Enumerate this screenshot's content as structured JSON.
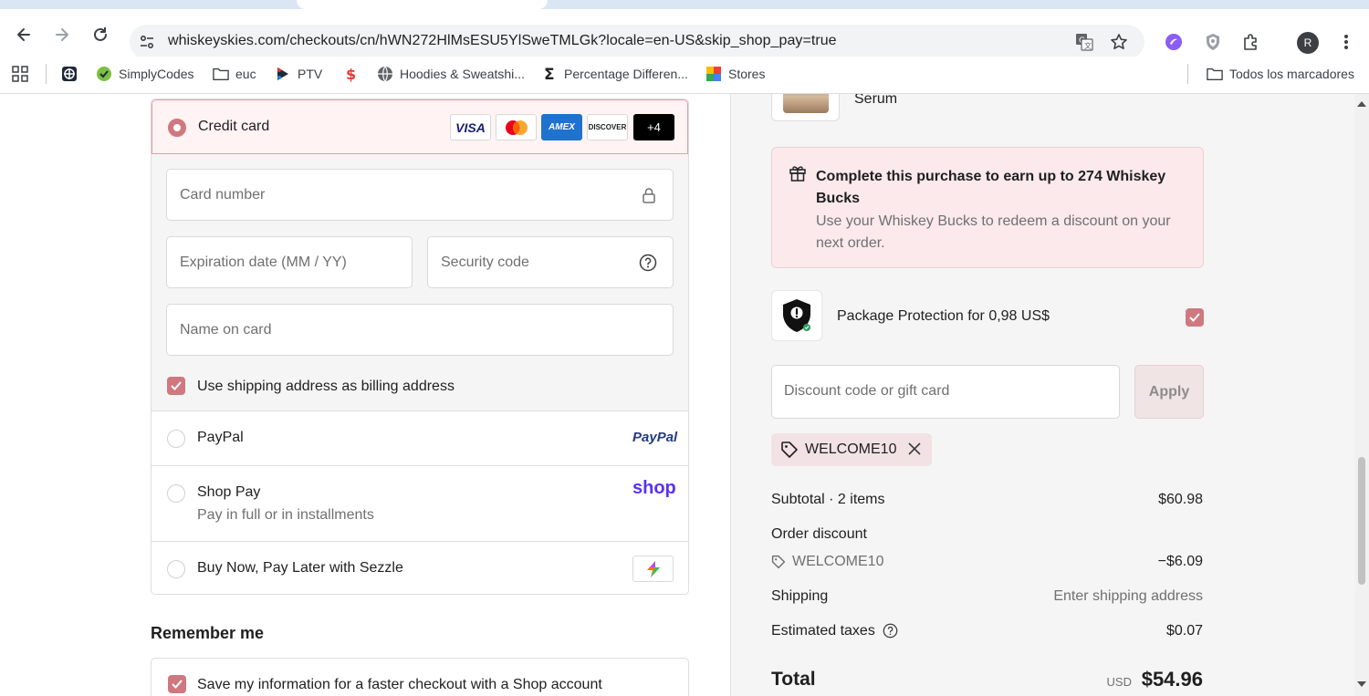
{
  "browser": {
    "url": "whiskeyskies.com/checkouts/cn/hWN272HlMsESU5YlSweTMLGk?locale=en-US&skip_shop_pay=true",
    "avatar_letter": "R"
  },
  "bookmarks": {
    "items": [
      "SimplyCodes",
      "euc",
      "PTV",
      "Hoodies & Sweatshi...",
      "Percentage Differen...",
      "Stores"
    ],
    "all_bookmarks": "Todos los marcadores"
  },
  "payment": {
    "credit_card_label": "Credit card",
    "card_brands": [
      "VISA",
      "Mastercard",
      "AMEX",
      "DISCOVER"
    ],
    "more_brands": "+4",
    "card_number_placeholder": "Card number",
    "expiration_placeholder": "Expiration date (MM / YY)",
    "security_placeholder": "Security code",
    "name_placeholder": "Name on card",
    "billing_checkbox_label": "Use shipping address as billing address",
    "paypal_label": "PayPal",
    "paypal_logo": "PayPal",
    "shoppay_label": "Shop Pay",
    "shoppay_sub": "Pay in full or in installments",
    "shoppay_logo": "shop",
    "sezzle_label": "Buy Now, Pay Later with Sezzle"
  },
  "remember": {
    "title": "Remember me",
    "save_label": "Save my information for a faster checkout with a Shop account"
  },
  "summary": {
    "item_name_fragment": "Serum",
    "promo_title": "Complete this purchase to earn up to 274 Whiskey Bucks",
    "promo_desc": "Use your Whiskey Bucks to redeem a discount on your next order.",
    "package_protection": "Package Protection for 0,98 US$",
    "discount_placeholder": "Discount code or gift card",
    "apply_label": "Apply",
    "applied_code": "WELCOME10",
    "subtotal_label": "Subtotal · 2 items",
    "subtotal_value": "$60.98",
    "order_discount_label": "Order discount",
    "discount_code": "WELCOME10",
    "discount_value": "−$6.09",
    "shipping_label": "Shipping",
    "shipping_value": "Enter shipping address",
    "taxes_label": "Estimated taxes",
    "taxes_value": "$0.07",
    "total_label": "Total",
    "currency": "USD",
    "total_value": "$54.96"
  },
  "colors": {
    "accent": "#cf7880",
    "promo_bg": "#fbe9eb",
    "shop_purple": "#5a31f4",
    "paypal_blue": "#253b80"
  }
}
